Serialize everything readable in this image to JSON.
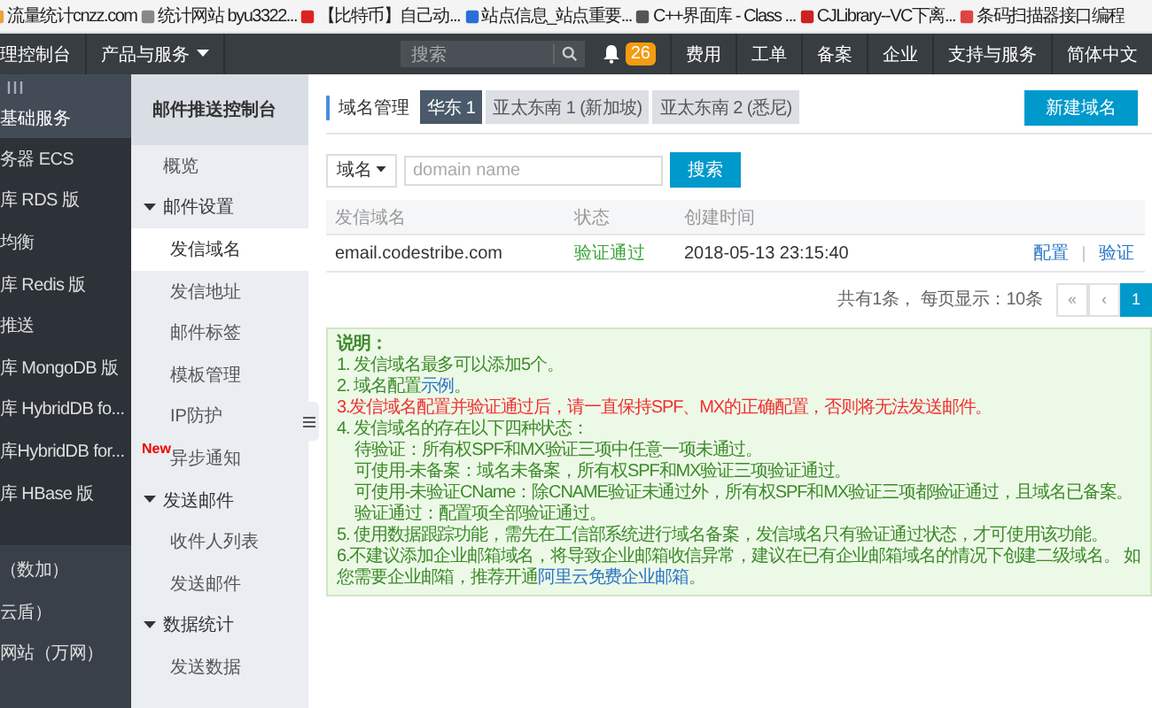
{
  "bookmarks": [
    {
      "label": "流量统计cnzz.com"
    },
    {
      "label": "统计网站 byu3322..."
    },
    {
      "label": "【比特币】自己动..."
    },
    {
      "label": "站点信息_站点重要..."
    },
    {
      "label": "C++界面库 - Class ..."
    },
    {
      "label": "CJLibrary--VC下离..."
    },
    {
      "label": "条码扫描器接口编程"
    }
  ],
  "topnav": {
    "console_title": "理控制台",
    "products_menu": "产品与服务",
    "search": {
      "placeholder": "搜索"
    },
    "notification_count": "26",
    "links": [
      "费用",
      "工单",
      "备案",
      "企业",
      "支持与服务",
      "简体中文"
    ]
  },
  "sidebar": {
    "sections": [
      {
        "title": "基础服务",
        "items": [
          "务器 ECS",
          "库 RDS 版",
          "均衡",
          "库 Redis 版",
          "推送",
          "库 MongoDB 版",
          "库 HybridDB fo...",
          "库HybridDB for...",
          "库 HBase 版"
        ]
      },
      {
        "items": [
          "（数加）",
          "云盾）",
          "网站（万网）"
        ]
      }
    ]
  },
  "console_nav": {
    "title": "邮件推送控制台",
    "items": [
      {
        "label": "概览",
        "selected": false
      },
      {
        "label": "邮件设置",
        "expanded": true,
        "children": [
          {
            "label": "发信域名",
            "selected": true
          },
          {
            "label": "发信地址",
            "selected": false
          },
          {
            "label": "邮件标签",
            "selected": false
          },
          {
            "label": "模板管理",
            "selected": false
          },
          {
            "label": "IP防护",
            "selected": false
          },
          {
            "label": "异步通知",
            "selected": false,
            "badge": "New"
          }
        ]
      },
      {
        "label": "发送邮件",
        "expanded": true,
        "children": [
          {
            "label": "收件人列表",
            "selected": false
          },
          {
            "label": "发送邮件",
            "selected": false
          }
        ]
      },
      {
        "label": "数据统计",
        "expanded": true,
        "children": [
          {
            "label": "发送数据",
            "selected": false
          }
        ]
      }
    ]
  },
  "main": {
    "title": "域名管理",
    "region_tabs": [
      {
        "label": "华东 1",
        "selected": true
      },
      {
        "label": "亚太东南 1 (新加坡)",
        "selected": false
      },
      {
        "label": "亚太东南 2 (悉尼)",
        "selected": false
      }
    ],
    "new_button": "新建域名",
    "search": {
      "field_select": "域名",
      "placeholder": "domain name",
      "button": "搜索"
    },
    "table": {
      "columns": [
        "发信域名",
        "状态",
        "创建时间"
      ],
      "rows": [
        {
          "domain": "email.codestribe.com",
          "status": "验证通过",
          "created": "2018-05-13 23:15:40",
          "actions": [
            "配置",
            "验证"
          ]
        }
      ]
    },
    "pagination": {
      "summary": "共有1条， 每页显示：10条",
      "pages": [
        {
          "label": "«",
          "selected": false
        },
        {
          "label": "‹",
          "selected": false
        },
        {
          "label": "1",
          "selected": true
        }
      ]
    },
    "notes": {
      "title": "说明：",
      "lines": [
        {
          "kind": "normal",
          "parts": [
            {
              "text": "1. 发信域名最多可以添加5个。"
            }
          ]
        },
        {
          "kind": "normal",
          "parts": [
            {
              "text": "2. 域名配置"
            },
            {
              "text": "示例",
              "kind": "link"
            },
            {
              "text": "。"
            }
          ]
        },
        {
          "kind": "warning",
          "parts": [
            {
              "text": "3.发信域名配置并验证通过后，请一直保持SPF、MX的正确配置，否则将无法发送邮件。"
            }
          ]
        },
        {
          "kind": "normal",
          "parts": [
            {
              "text": "4. 发信域名的存在以下四种状态："
            }
          ]
        },
        {
          "kind": "indent",
          "parts": [
            {
              "text": "待验证：所有权SPF和MX验证三项中任意一项未通过。"
            }
          ]
        },
        {
          "kind": "indent",
          "parts": [
            {
              "text": "可使用-未备案：域名未备案，所有权SPF和MX验证三项验证通过。"
            }
          ]
        },
        {
          "kind": "indent",
          "parts": [
            {
              "text": "可使用-未验证CName：除CNAME验证未通过外，所有权SPF和MX验证三项都验证通过，且域名已备案。"
            }
          ]
        },
        {
          "kind": "indent",
          "parts": [
            {
              "text": "验证通过：配置项全部验证通过。"
            }
          ]
        },
        {
          "kind": "normal",
          "parts": [
            {
              "text": "5. 使用数据跟踪功能，需先在工信部系统进行域名备案，发信域名只有验证通过状态，才可使用该功能。"
            }
          ]
        },
        {
          "kind": "normal",
          "parts": [
            {
              "text": "6.不建议添加企业邮箱域名，将导致企业邮箱收信异常，建议在已有企业邮箱域名的情况下创建二级域名。 如您需要企业邮箱，推荐开通"
            },
            {
              "text": "阿里云免费企业邮箱",
              "kind": "link"
            },
            {
              "text": "。"
            }
          ]
        }
      ]
    }
  }
}
